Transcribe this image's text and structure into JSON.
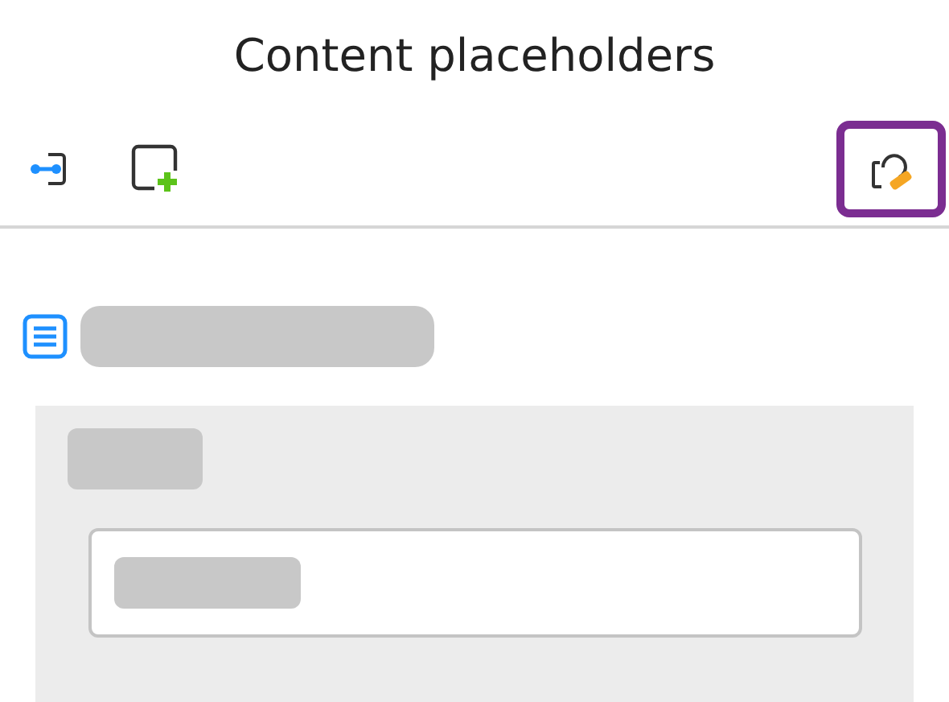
{
  "window": {
    "title": "Content placeholders"
  },
  "toolbar": [
    {
      "kind": "connector",
      "selected": false
    },
    {
      "kind": "add",
      "selected": false
    },
    {
      "kind": "edit",
      "selected": true
    }
  ]
}
